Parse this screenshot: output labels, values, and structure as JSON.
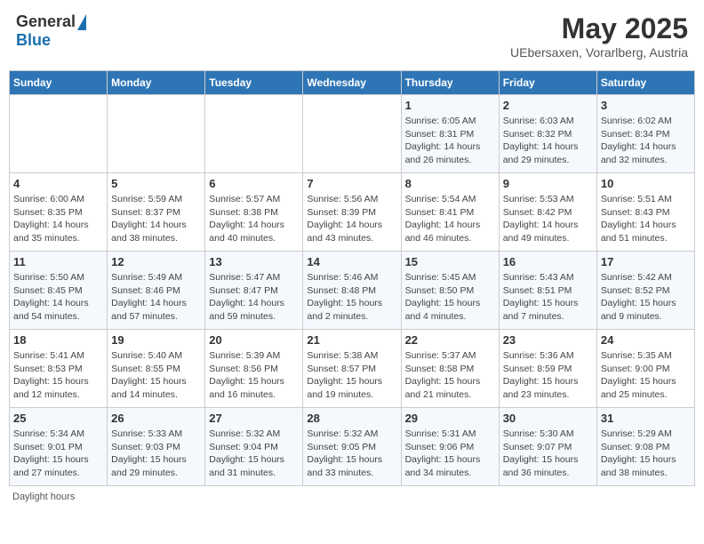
{
  "header": {
    "logo_general": "General",
    "logo_blue": "Blue",
    "month_title": "May 2025",
    "location": "UEbersaxen, Vorarlberg, Austria"
  },
  "days_of_week": [
    "Sunday",
    "Monday",
    "Tuesday",
    "Wednesday",
    "Thursday",
    "Friday",
    "Saturday"
  ],
  "footer": {
    "daylight_label": "Daylight hours"
  },
  "weeks": [
    [
      {
        "day": "",
        "info": ""
      },
      {
        "day": "",
        "info": ""
      },
      {
        "day": "",
        "info": ""
      },
      {
        "day": "",
        "info": ""
      },
      {
        "day": "1",
        "info": "Sunrise: 6:05 AM\nSunset: 8:31 PM\nDaylight: 14 hours\nand 26 minutes."
      },
      {
        "day": "2",
        "info": "Sunrise: 6:03 AM\nSunset: 8:32 PM\nDaylight: 14 hours\nand 29 minutes."
      },
      {
        "day": "3",
        "info": "Sunrise: 6:02 AM\nSunset: 8:34 PM\nDaylight: 14 hours\nand 32 minutes."
      }
    ],
    [
      {
        "day": "4",
        "info": "Sunrise: 6:00 AM\nSunset: 8:35 PM\nDaylight: 14 hours\nand 35 minutes."
      },
      {
        "day": "5",
        "info": "Sunrise: 5:59 AM\nSunset: 8:37 PM\nDaylight: 14 hours\nand 38 minutes."
      },
      {
        "day": "6",
        "info": "Sunrise: 5:57 AM\nSunset: 8:38 PM\nDaylight: 14 hours\nand 40 minutes."
      },
      {
        "day": "7",
        "info": "Sunrise: 5:56 AM\nSunset: 8:39 PM\nDaylight: 14 hours\nand 43 minutes."
      },
      {
        "day": "8",
        "info": "Sunrise: 5:54 AM\nSunset: 8:41 PM\nDaylight: 14 hours\nand 46 minutes."
      },
      {
        "day": "9",
        "info": "Sunrise: 5:53 AM\nSunset: 8:42 PM\nDaylight: 14 hours\nand 49 minutes."
      },
      {
        "day": "10",
        "info": "Sunrise: 5:51 AM\nSunset: 8:43 PM\nDaylight: 14 hours\nand 51 minutes."
      }
    ],
    [
      {
        "day": "11",
        "info": "Sunrise: 5:50 AM\nSunset: 8:45 PM\nDaylight: 14 hours\nand 54 minutes."
      },
      {
        "day": "12",
        "info": "Sunrise: 5:49 AM\nSunset: 8:46 PM\nDaylight: 14 hours\nand 57 minutes."
      },
      {
        "day": "13",
        "info": "Sunrise: 5:47 AM\nSunset: 8:47 PM\nDaylight: 14 hours\nand 59 minutes."
      },
      {
        "day": "14",
        "info": "Sunrise: 5:46 AM\nSunset: 8:48 PM\nDaylight: 15 hours\nand 2 minutes."
      },
      {
        "day": "15",
        "info": "Sunrise: 5:45 AM\nSunset: 8:50 PM\nDaylight: 15 hours\nand 4 minutes."
      },
      {
        "day": "16",
        "info": "Sunrise: 5:43 AM\nSunset: 8:51 PM\nDaylight: 15 hours\nand 7 minutes."
      },
      {
        "day": "17",
        "info": "Sunrise: 5:42 AM\nSunset: 8:52 PM\nDaylight: 15 hours\nand 9 minutes."
      }
    ],
    [
      {
        "day": "18",
        "info": "Sunrise: 5:41 AM\nSunset: 8:53 PM\nDaylight: 15 hours\nand 12 minutes."
      },
      {
        "day": "19",
        "info": "Sunrise: 5:40 AM\nSunset: 8:55 PM\nDaylight: 15 hours\nand 14 minutes."
      },
      {
        "day": "20",
        "info": "Sunrise: 5:39 AM\nSunset: 8:56 PM\nDaylight: 15 hours\nand 16 minutes."
      },
      {
        "day": "21",
        "info": "Sunrise: 5:38 AM\nSunset: 8:57 PM\nDaylight: 15 hours\nand 19 minutes."
      },
      {
        "day": "22",
        "info": "Sunrise: 5:37 AM\nSunset: 8:58 PM\nDaylight: 15 hours\nand 21 minutes."
      },
      {
        "day": "23",
        "info": "Sunrise: 5:36 AM\nSunset: 8:59 PM\nDaylight: 15 hours\nand 23 minutes."
      },
      {
        "day": "24",
        "info": "Sunrise: 5:35 AM\nSunset: 9:00 PM\nDaylight: 15 hours\nand 25 minutes."
      }
    ],
    [
      {
        "day": "25",
        "info": "Sunrise: 5:34 AM\nSunset: 9:01 PM\nDaylight: 15 hours\nand 27 minutes."
      },
      {
        "day": "26",
        "info": "Sunrise: 5:33 AM\nSunset: 9:03 PM\nDaylight: 15 hours\nand 29 minutes."
      },
      {
        "day": "27",
        "info": "Sunrise: 5:32 AM\nSunset: 9:04 PM\nDaylight: 15 hours\nand 31 minutes."
      },
      {
        "day": "28",
        "info": "Sunrise: 5:32 AM\nSunset: 9:05 PM\nDaylight: 15 hours\nand 33 minutes."
      },
      {
        "day": "29",
        "info": "Sunrise: 5:31 AM\nSunset: 9:06 PM\nDaylight: 15 hours\nand 34 minutes."
      },
      {
        "day": "30",
        "info": "Sunrise: 5:30 AM\nSunset: 9:07 PM\nDaylight: 15 hours\nand 36 minutes."
      },
      {
        "day": "31",
        "info": "Sunrise: 5:29 AM\nSunset: 9:08 PM\nDaylight: 15 hours\nand 38 minutes."
      }
    ]
  ]
}
